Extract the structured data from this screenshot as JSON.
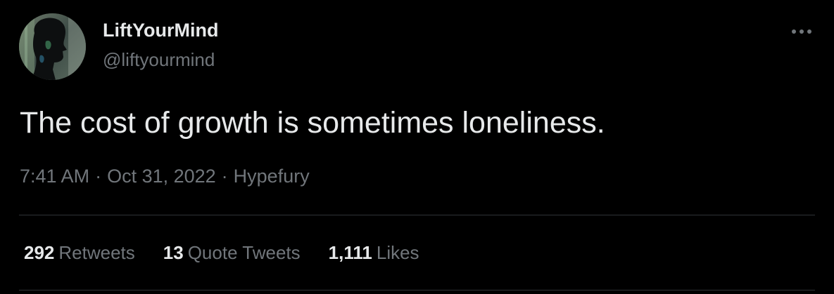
{
  "author": {
    "display_name": "LiftYourMind",
    "handle": "@liftyourmind",
    "avatar_icon": "profile-silhouette-avatar"
  },
  "tweet": {
    "text": "The cost of growth is sometimes loneliness.",
    "time": "7:41 AM",
    "date": "Oct 31, 2022",
    "source": "Hypefury",
    "separator": "·"
  },
  "stats": {
    "retweets": {
      "count": "292",
      "label": "Retweets"
    },
    "quote_tweets": {
      "count": "13",
      "label": "Quote Tweets"
    },
    "likes": {
      "count": "1,111",
      "label": "Likes"
    }
  },
  "icons": {
    "more": "more-options-icon"
  },
  "colors": {
    "background": "#000000",
    "primary_text": "#e7e9ea",
    "secondary_text": "#71767b",
    "divider": "#2f3336"
  }
}
